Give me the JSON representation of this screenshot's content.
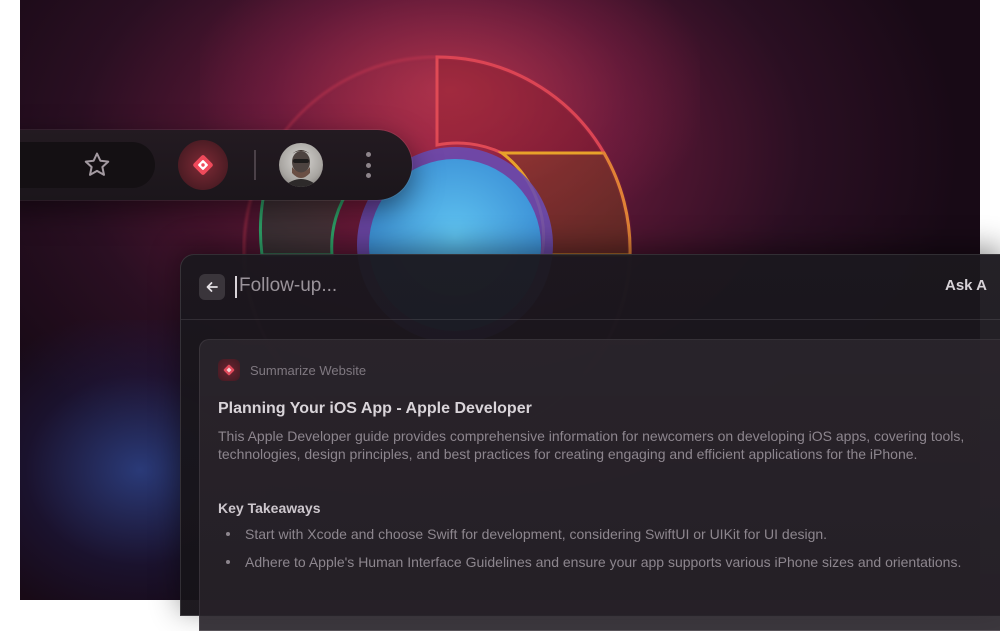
{
  "toolbar": {
    "bookmark_icon": "star-icon",
    "extension_icon": "assistant-extension-icon",
    "profile_icon": "avatar",
    "menu_icon": "more-vertical-icon"
  },
  "panel": {
    "back_icon": "arrow-left-icon",
    "input_placeholder": "Follow-up...",
    "ask_label": "Ask A",
    "card": {
      "label": "Summarize Website",
      "title": "Planning Your iOS App - Apple Developer",
      "body": "This Apple Developer guide provides comprehensive information for newcomers on developing iOS apps, covering tools, technologies, design principles, and best practices for creating engaging and efficient applications for the iPhone.",
      "subtitle": "Key Takeaways",
      "bullets": [
        "Start with Xcode and choose Swift for development, considering SwiftUI or UIKit for UI design.",
        "Adhere to Apple's Human Interface Guidelines and ensure your app supports various iPhone sizes and orientations."
      ]
    }
  },
  "colors": {
    "accent": "#c7334f",
    "panel_bg": "#1b181e",
    "text_primary": "#d9d4d9",
    "text_secondary": "#8d868e"
  }
}
